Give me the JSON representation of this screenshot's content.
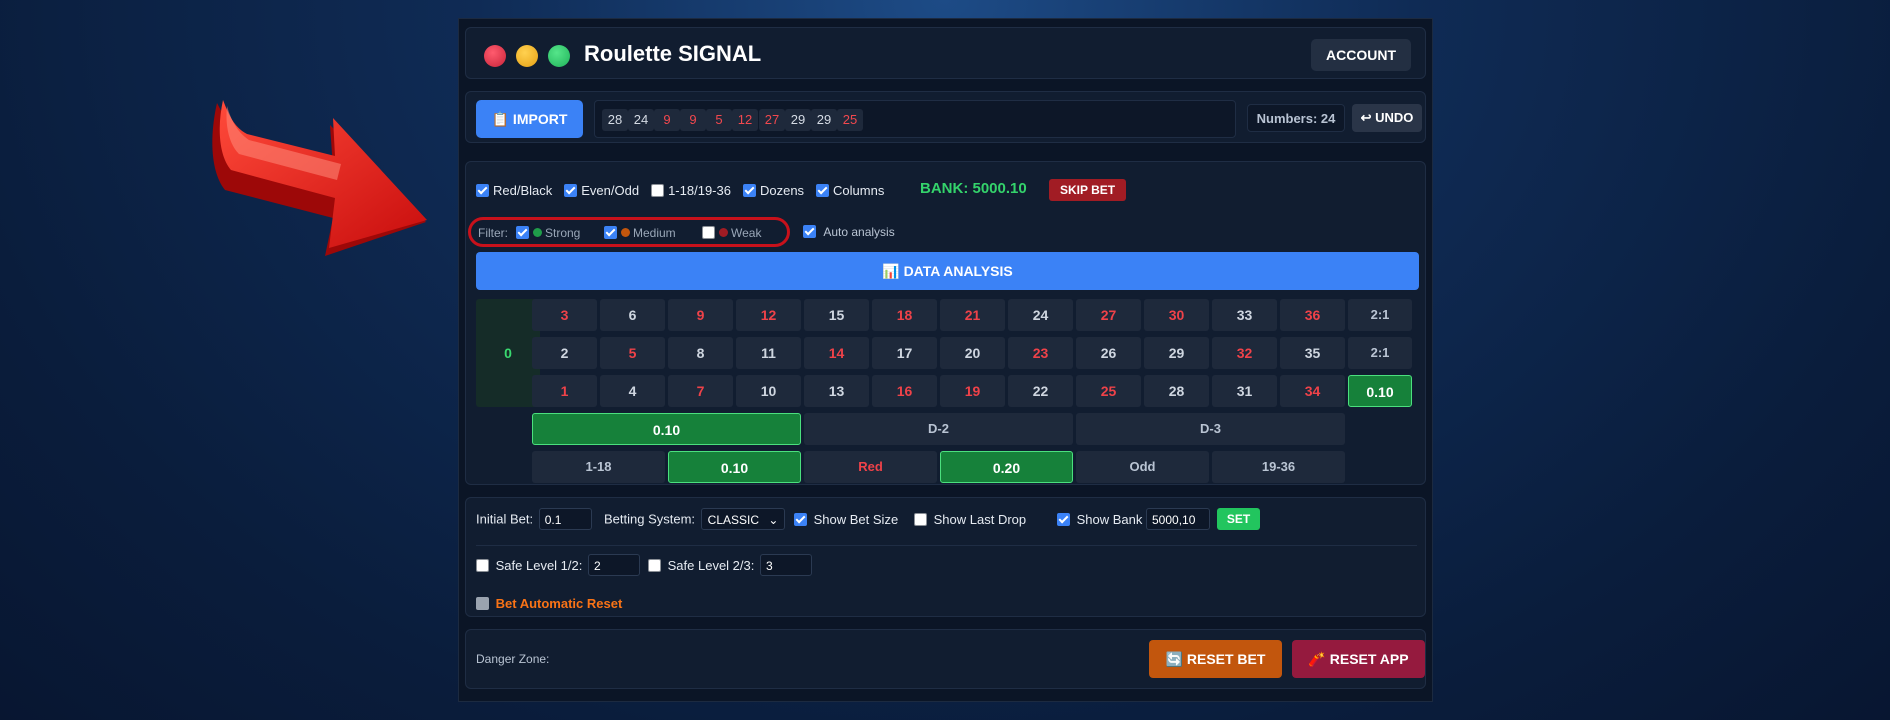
{
  "header": {
    "title": "Roulette SIGNAL",
    "account_label": "ACCOUNT"
  },
  "import_bar": {
    "import_label": "📋 IMPORT",
    "history": [
      {
        "n": "28",
        "color": "black"
      },
      {
        "n": "24",
        "color": "black"
      },
      {
        "n": "9",
        "color": "red"
      },
      {
        "n": "9",
        "color": "red"
      },
      {
        "n": "5",
        "color": "red"
      },
      {
        "n": "12",
        "color": "red"
      },
      {
        "n": "27",
        "color": "red"
      },
      {
        "n": "29",
        "color": "black"
      },
      {
        "n": "29",
        "color": "black"
      },
      {
        "n": "25",
        "color": "red"
      }
    ],
    "count_label": "Numbers: 24",
    "undo_label": "↩ UNDO"
  },
  "options": {
    "items": [
      {
        "label": "Red/Black",
        "checked": true
      },
      {
        "label": "Even/Odd",
        "checked": true
      },
      {
        "label": "1-18/19-36",
        "checked": false
      },
      {
        "label": "Dozens",
        "checked": true
      },
      {
        "label": "Columns",
        "checked": true
      }
    ],
    "bank": "BANK: 5000.10",
    "skip_bet_label": "SKIP BET"
  },
  "filter": {
    "title": "Filter:",
    "items": [
      {
        "label": "Strong",
        "checked": true,
        "color": "#1f9d4a"
      },
      {
        "label": "Medium",
        "checked": true,
        "color": "#c2560d"
      },
      {
        "label": "Weak",
        "checked": false,
        "color": "#a11c24"
      }
    ],
    "auto_analysis": {
      "label": "Auto analysis",
      "checked": true
    }
  },
  "analysis_button": "📊 DATA ANALYSIS",
  "table": {
    "zero": "0",
    "rows": [
      [
        "3",
        "6",
        "9",
        "12",
        "15",
        "18",
        "21",
        "24",
        "27",
        "30",
        "33",
        "36"
      ],
      [
        "2",
        "5",
        "8",
        "11",
        "14",
        "17",
        "20",
        "23",
        "26",
        "29",
        "32",
        "35"
      ],
      [
        "1",
        "4",
        "7",
        "10",
        "13",
        "16",
        "19",
        "22",
        "25",
        "28",
        "31",
        "34"
      ]
    ],
    "red_numbers": [
      "1",
      "3",
      "5",
      "7",
      "9",
      "12",
      "14",
      "16",
      "18",
      "19",
      "21",
      "23",
      "25",
      "27",
      "30",
      "32",
      "34",
      "36"
    ],
    "columns": [
      {
        "text": "2:1",
        "highlight": false
      },
      {
        "text": "2:1",
        "highlight": false
      },
      {
        "text": "0.10",
        "highlight": true
      }
    ],
    "dozens": [
      {
        "text": "0.10",
        "highlight": true
      },
      {
        "text": "D-2",
        "highlight": false
      },
      {
        "text": "D-3",
        "highlight": false
      }
    ],
    "outside": [
      {
        "text": "1-18",
        "highlight": false,
        "red": false
      },
      {
        "text": "0.10",
        "highlight": true,
        "red": false
      },
      {
        "text": "Red",
        "highlight": false,
        "red": true
      },
      {
        "text": "0.20",
        "highlight": true,
        "red": false
      },
      {
        "text": "Odd",
        "highlight": false,
        "red": false
      },
      {
        "text": "19-36",
        "highlight": false,
        "red": false
      }
    ]
  },
  "settings": {
    "initial_bet_label": "Initial Bet:",
    "initial_bet_value": "0.1",
    "betting_system_label": "Betting System:",
    "betting_system_value": "CLASSIC",
    "show_bet_size": {
      "label": "Show Bet Size",
      "checked": true
    },
    "show_last_drop": {
      "label": "Show Last Drop",
      "checked": false
    },
    "show_bank": {
      "label": "Show Bank",
      "checked": true
    },
    "bank_input_value": "5000,10",
    "set_label": "SET",
    "safe_level_12": {
      "label": "Safe Level 1/2:",
      "checked": false,
      "value": "2"
    },
    "safe_level_23": {
      "label": "Safe Level 2/3:",
      "checked": false,
      "value": "3"
    },
    "auto_reset_label": "Bet Automatic Reset"
  },
  "danger": {
    "label": "Danger Zone:",
    "reset_bet_label": "🔄 RESET BET",
    "reset_app_label": "🧨 RESET APP"
  },
  "colors": {
    "accent_blue": "#3b82f6",
    "highlight_green": "#16813a",
    "red_number": "#ef4249",
    "arrow_red": "#e01818"
  }
}
